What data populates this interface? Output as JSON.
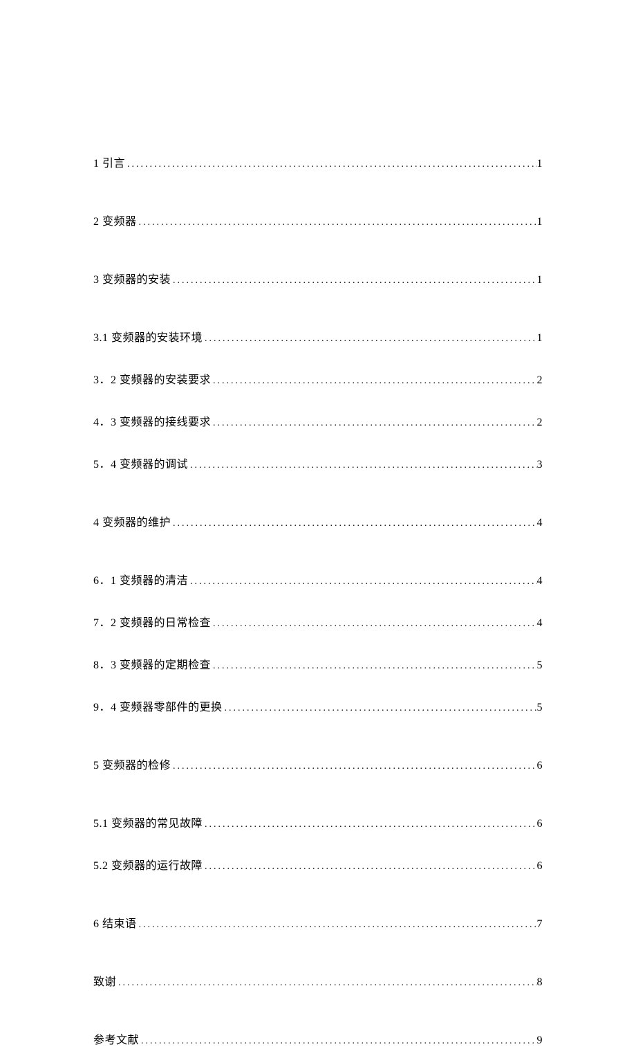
{
  "toc": [
    {
      "label": "1 引言",
      "page": "1",
      "spaced": true
    },
    {
      "label": "2 变频器",
      "page": "1",
      "spaced": true
    },
    {
      "label": "3 变频器的安装",
      "page": "1",
      "spaced": true
    },
    {
      "label": "3.1 变频器的安装环境",
      "page": "1",
      "spaced": false
    },
    {
      "label": "3．2 变频器的安装要求",
      "page": "2",
      "spaced": false
    },
    {
      "label": "4．3 变频器的接线要求",
      "page": "2",
      "spaced": false
    },
    {
      "label": "5．4 变频器的调试",
      "page": "3",
      "spaced": true
    },
    {
      "label": "4 变频器的维护",
      "page": "4",
      "spaced": true
    },
    {
      "label": "6．1 变频器的清洁",
      "page": "4",
      "spaced": false
    },
    {
      "label": "7．2 变频器的日常检查",
      "page": "4",
      "spaced": false
    },
    {
      "label": "8．3 变频器的定期检查",
      "page": "5",
      "spaced": false
    },
    {
      "label": "9．4 变频器零部件的更换",
      "page": "5",
      "spaced": true
    },
    {
      "label": "5 变频器的检修",
      "page": "6",
      "spaced": true
    },
    {
      "label": "5.1 变频器的常见故障",
      "page": "6",
      "spaced": false
    },
    {
      "label": "5.2 变频器的运行故障",
      "page": "6",
      "spaced": true
    },
    {
      "label": "6 结束语",
      "page": "7",
      "spaced": true
    },
    {
      "label": "致谢",
      "page": "8",
      "spaced": true
    },
    {
      "label": "参考文献",
      "page": "9",
      "spaced": false
    }
  ],
  "dots": "................................................................................................"
}
